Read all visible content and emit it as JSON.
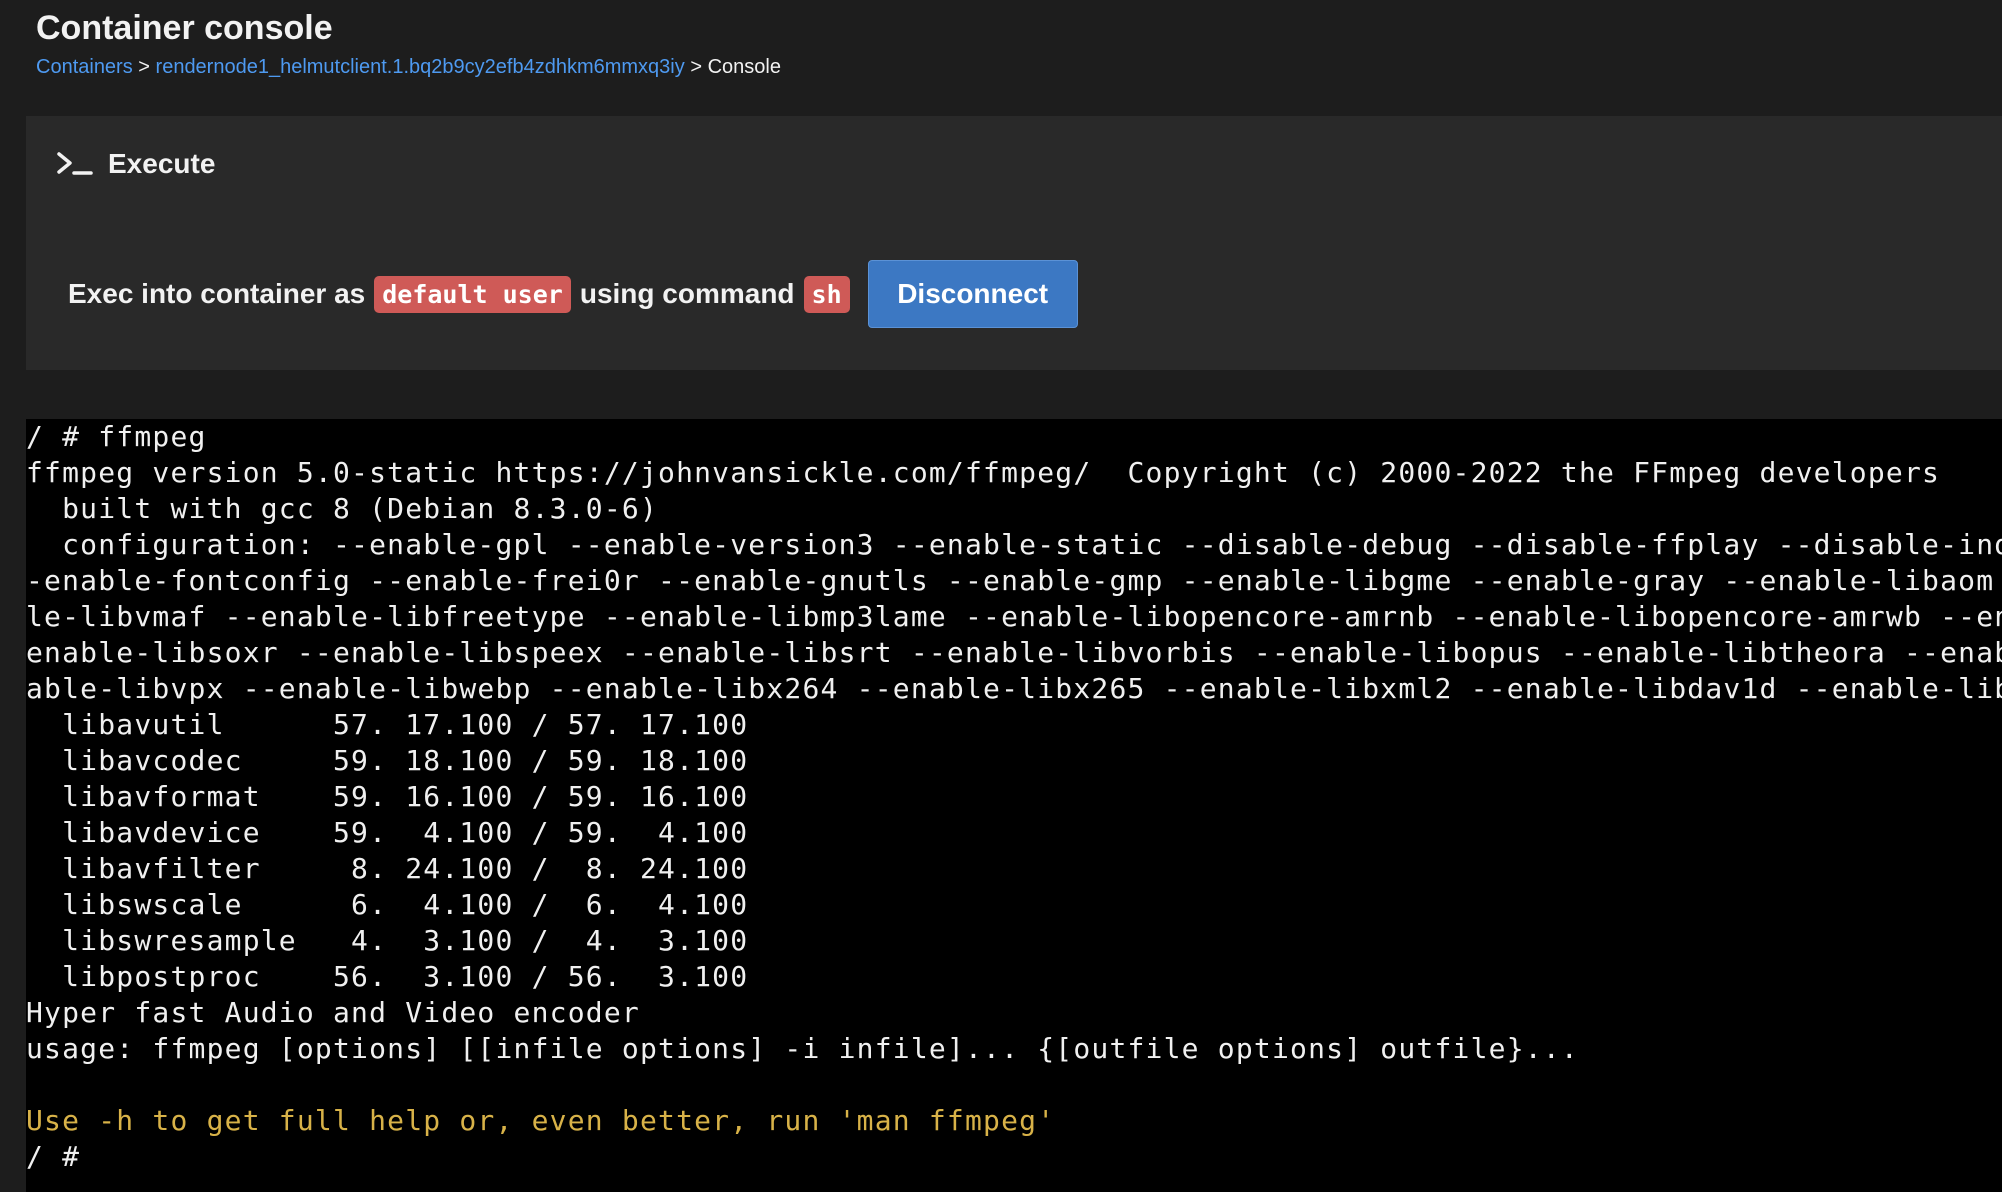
{
  "page": {
    "title": "Container console"
  },
  "breadcrumb": {
    "root": "Containers",
    "container": "rendernode1_helmutclient.1.bq2b9cy2efb4zdhkm6mmxq3iy",
    "separator": ">",
    "current": "Console"
  },
  "execute_panel": {
    "icon": "terminal-icon",
    "title": "Execute",
    "exec_text_before": "Exec into container as",
    "user_badge": "default user",
    "exec_text_middle": "using command",
    "command_badge": "sh",
    "disconnect_label": "Disconnect"
  },
  "colors": {
    "link": "#4e9af1",
    "badge": "#cf5a57",
    "button": "#3c78c3",
    "terminal_bg": "#000000",
    "terminal_hint": "#d8b248"
  },
  "terminal": {
    "lines": [
      "/ # ffmpeg",
      "ffmpeg version 5.0-static https://johnvansickle.com/ffmpeg/  Copyright (c) 2000-2022 the FFmpeg developers",
      "  built with gcc 8 (Debian 8.3.0-6)",
      "  configuration: --enable-gpl --enable-version3 --enable-static --disable-debug --disable-ffplay --disable-ind",
      "-enable-fontconfig --enable-frei0r --enable-gnutls --enable-gmp --enable-libgme --enable-gray --enable-libaom",
      "le-libvmaf --enable-libfreetype --enable-libmp3lame --enable-libopencore-amrnb --enable-libopencore-amrwb --en",
      "enable-libsoxr --enable-libspeex --enable-libsrt --enable-libvorbis --enable-libopus --enable-libtheora --enab",
      "able-libvpx --enable-libwebp --enable-libx264 --enable-libx265 --enable-libxml2 --enable-libdav1d --enable-lib",
      "  libavutil      57. 17.100 / 57. 17.100",
      "  libavcodec     59. 18.100 / 59. 18.100",
      "  libavformat    59. 16.100 / 59. 16.100",
      "  libavdevice    59.  4.100 / 59.  4.100",
      "  libavfilter     8. 24.100 /  8. 24.100",
      "  libswscale      6.  4.100 /  6.  4.100",
      "  libswresample   4.  3.100 /  4.  3.100",
      "  libpostproc    56.  3.100 / 56.  3.100",
      "Hyper fast Audio and Video encoder",
      "usage: ffmpeg [options] [[infile options] -i infile]... {[outfile options] outfile}...",
      "",
      "Use -h to get full help or, even better, run 'man ffmpeg'",
      "/ #"
    ]
  }
}
